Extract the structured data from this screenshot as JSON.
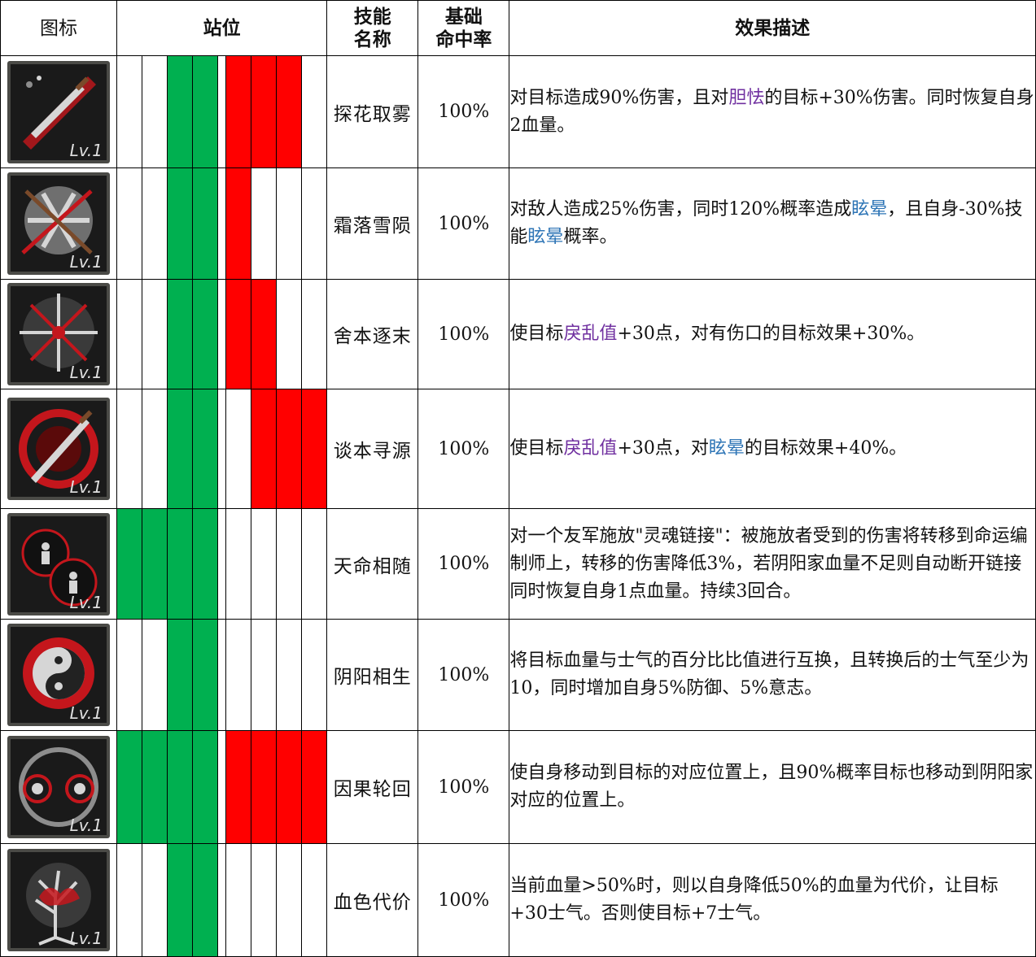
{
  "headers": {
    "icon": "图标",
    "position": "站位",
    "skill_name": "技能\n名称",
    "skill_name_line1": "技能",
    "skill_name_line2": "名称",
    "hit_rate_line1": "基础",
    "hit_rate_line2": "命中率",
    "effect": "效果描述"
  },
  "colors": {
    "green": "#00b050",
    "red": "#ff0000",
    "purple": "#7030a0",
    "blue": "#2e75b6",
    "crimson": "#c00000"
  },
  "rows": [
    {
      "icon": "dagger-slash-icon",
      "level": "Lv.1",
      "slots": [
        "w",
        "w",
        "g",
        "g",
        "red",
        "red",
        "red",
        "w"
      ],
      "name": "探花取雾",
      "rate": "100%",
      "desc": [
        {
          "t": "对目标造成90%伤害，且对"
        },
        {
          "t": "胆怯",
          "c": "purple"
        },
        {
          "t": "的目标+30%伤害。同时恢复自身2血量。"
        }
      ]
    },
    {
      "icon": "snowflake-arrows-icon",
      "level": "Lv.1",
      "slots": [
        "w",
        "w",
        "g",
        "g",
        "red",
        "w",
        "w",
        "w"
      ],
      "name": "霜落雪陨",
      "rate": "100%",
      "desc": [
        {
          "t": "对敌人造成25%伤害，同时120%概率造成"
        },
        {
          "t": "眩晕",
          "c": "blue"
        },
        {
          "t": "，且自身-30%技能"
        },
        {
          "t": "眩晕",
          "c": "blue"
        },
        {
          "t": "概率。"
        }
      ]
    },
    {
      "icon": "shattered-star-icon",
      "level": "Lv.1",
      "slots": [
        "w",
        "w",
        "g",
        "g",
        "red",
        "red",
        "w",
        "w"
      ],
      "name": "舍本逐末",
      "rate": "100%",
      "desc": [
        {
          "t": "使目标"
        },
        {
          "t": "戾乱值",
          "c": "purple"
        },
        {
          "t": "+30点，对有"
        },
        {
          "t": "伤口",
          "c": "crimson"
        },
        {
          "t": "的目标效果+30%。"
        }
      ]
    },
    {
      "icon": "vortex-dagger-icon",
      "level": "Lv.1",
      "slots": [
        "w",
        "w",
        "g",
        "g",
        "w",
        "red",
        "red",
        "red"
      ],
      "name": "谈本寻源",
      "rate": "100%",
      "desc": [
        {
          "t": "使目标"
        },
        {
          "t": "戾乱值",
          "c": "purple"
        },
        {
          "t": "+30点，对"
        },
        {
          "t": "眩晕",
          "c": "blue"
        },
        {
          "t": "的目标效果+40%。"
        }
      ]
    },
    {
      "icon": "soul-link-icon",
      "level": "Lv.1",
      "slots": [
        "g",
        "g",
        "g",
        "g",
        "w",
        "w",
        "w",
        "w"
      ],
      "name": "天命相随",
      "rate": "100%",
      "desc": [
        {
          "t": "对一个友军施放\"灵魂链接\"：被施放者受到的伤害将转移到命运编制师上，转移的伤害降低3%，若阴阳家血量不足则自动断开链接同时恢复自身1点血量。持续3回合。"
        }
      ]
    },
    {
      "icon": "yin-yang-icon",
      "level": "Lv.1",
      "slots": [
        "w",
        "w",
        "g",
        "g",
        "w",
        "w",
        "w",
        "w"
      ],
      "name": "阴阳相生",
      "rate": "100%",
      "desc": [
        {
          "t": "将目标血量与士气的百分比比值进行互换，且转换后的士气至少为10，同时增加自身5%防御、5%意志。"
        }
      ]
    },
    {
      "icon": "twin-eyes-icon",
      "level": "Lv.1",
      "slots": [
        "g",
        "g",
        "g",
        "g",
        "red",
        "red",
        "red",
        "red"
      ],
      "name": "因果轮回",
      "rate": "100%",
      "desc": [
        {
          "t": "使自身移动到目标的对应位置上，且90%概率目标也移动到阴阳家对应的位置上。"
        }
      ]
    },
    {
      "icon": "blood-tree-icon",
      "level": "Lv.1",
      "slots": [
        "w",
        "w",
        "g",
        "g",
        "w",
        "w",
        "w",
        "w"
      ],
      "name": "血色代价",
      "rate": "100%",
      "desc": [
        {
          "t": "当前血量>50%时，则以自身降低50%的血量为代价，让目标+30士气。否则使目标+7士气。"
        }
      ]
    }
  ]
}
